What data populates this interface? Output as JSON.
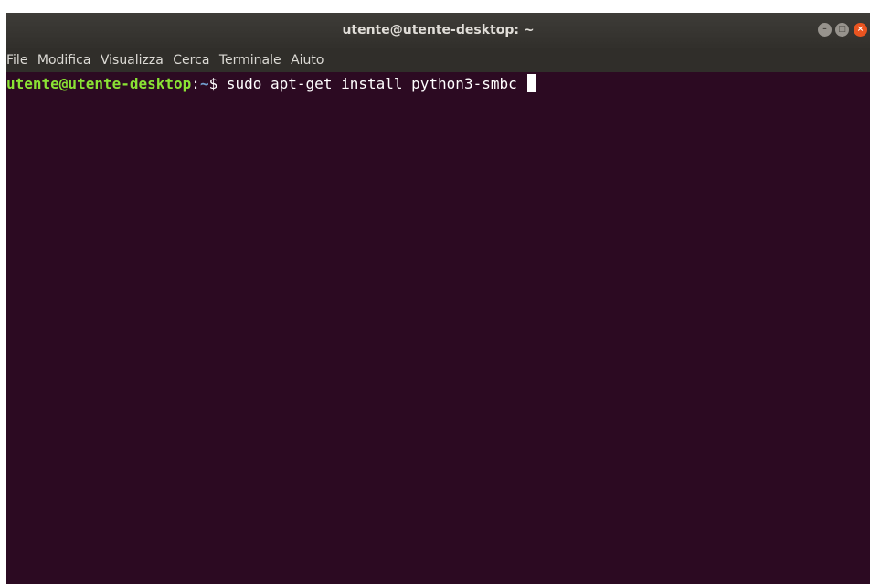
{
  "window": {
    "title": "utente@utente-desktop: ~",
    "controls": {
      "minimize_icon": "minimize-icon",
      "maximize_icon": "maximize-icon",
      "close_icon": "close-icon",
      "minimize_glyph": "–",
      "maximize_glyph": "□",
      "close_glyph": "×"
    }
  },
  "menu": {
    "items": [
      "File",
      "Modifica",
      "Visualizza",
      "Cerca",
      "Terminale",
      "Aiuto"
    ]
  },
  "terminal": {
    "user_host": "utente@utente-desktop",
    "separator": ":",
    "path": "~",
    "prompt_symbol": "$",
    "command": " sudo apt-get install python3-smbc "
  },
  "colors": {
    "background": "#2c0a22",
    "user_host": "#8ae234",
    "path": "#729fcf",
    "text": "#ffffff",
    "close_button": "#e95420"
  }
}
